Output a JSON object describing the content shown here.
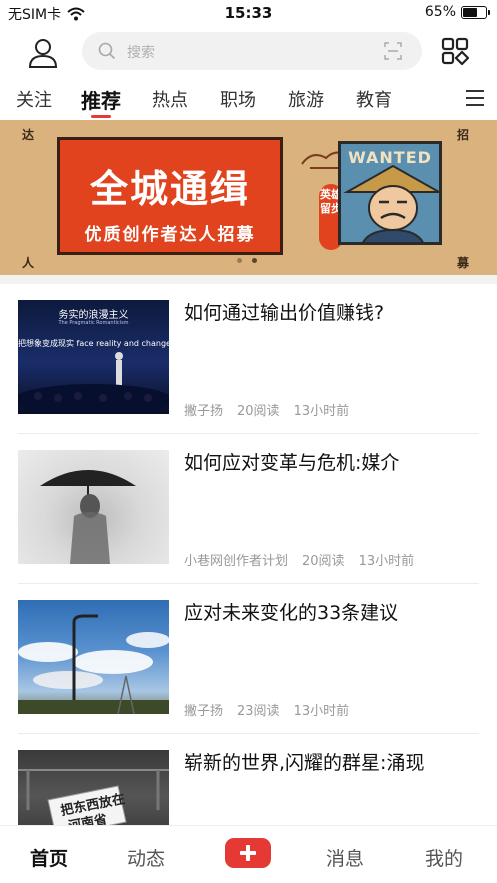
{
  "status_bar": {
    "carrier": "无SIM卡",
    "time": "15:33",
    "battery": "65%",
    "battery_level": 0.65
  },
  "header": {
    "search_placeholder": "搜索"
  },
  "tabs": [
    {
      "label": "关注"
    },
    {
      "label": "推荐",
      "active": true
    },
    {
      "label": "热点"
    },
    {
      "label": "职场"
    },
    {
      "label": "旅游"
    },
    {
      "label": "教育"
    }
  ],
  "banner": {
    "title": "全城通缉",
    "subtitle": "优质创作者达人招募",
    "corner_tl": "达",
    "corner_tr": "招",
    "corner_bl": "人",
    "corner_br": "募",
    "badge": "英雄留步",
    "poster_text": "WANTED",
    "slide_count": 2,
    "active_slide": 2
  },
  "articles": [
    {
      "title": "如何通过输出价值赚钱?",
      "author": "撇子扬",
      "reads": "20阅读",
      "time": "13小时前",
      "thumb_text": {
        "line1": "务实的浪漫主义",
        "line2": "The Pragmatic Romanticism",
        "line3": "把想象变成现实 face reality and change"
      }
    },
    {
      "title": "如何应对变革与危机:媒介",
      "author": "小巷网创作者计划",
      "reads": "20阅读",
      "time": "13小时前"
    },
    {
      "title": "应对未来变化的33条建议",
      "author": "撇子扬",
      "reads": "23阅读",
      "time": "13小时前"
    },
    {
      "title": "崭新的世界,闪耀的群星:涌现",
      "thumb_text": {
        "line1": "把东西放在",
        "line2": "河南省"
      }
    }
  ],
  "bottom_nav": {
    "home": "首页",
    "feed": "动态",
    "messages": "消息",
    "mine": "我的"
  },
  "colors": {
    "accent": "#e53935",
    "banner_bg": "#d9b27e",
    "banner_red": "#e2431f"
  }
}
